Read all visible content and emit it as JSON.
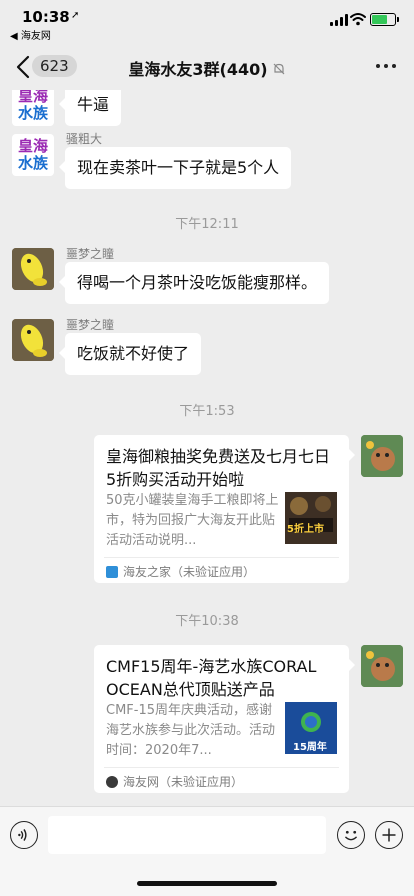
{
  "status_bar": {
    "time": "10:38",
    "back_app": "◀ 海友网",
    "location_arrow": "➚",
    "battery_color": "#34c759"
  },
  "nav": {
    "unread_count": "623",
    "title": "皇海水友3群(440)"
  },
  "avatars": {
    "huanghai_line1": "皇海",
    "huanghai_line2": "水族"
  },
  "messages": [
    {
      "sender": "",
      "text": "牛逼"
    },
    {
      "sender": "骚粗大",
      "text": "现在卖茶叶一下子就是5个人"
    },
    {
      "sender": "噩梦之瞳",
      "text": "得喝一个月茶叶没吃饭能瘦那样。"
    },
    {
      "sender": "噩梦之瞳",
      "text": "吃饭就不好使了"
    }
  ],
  "timestamps": [
    "下午12:11",
    "下午1:53",
    "下午10:38"
  ],
  "cards": [
    {
      "title": "皇海御粮抽奖免费送及七月七日5折购买活动开始啦",
      "description": "50克小罐装皇海手工粮即将上市，特为回报广大海友开此贴活动活动说明...",
      "thumb_text": "5折上市",
      "source": "海友之家（未验证应用）"
    },
    {
      "title": "CMF15周年-海艺水族CORAL OCEAN总代顶贴送产品",
      "description": "CMF-15周年庆典活动，感谢海艺水族参与此次活动。活动时间：2020年7...",
      "thumb_text": "15周年",
      "source": "海友网（未验证应用）"
    }
  ],
  "colors": {
    "chat_bg": "#ededed",
    "bubble": "#ffffff",
    "muted_text": "#9a9a9a"
  }
}
